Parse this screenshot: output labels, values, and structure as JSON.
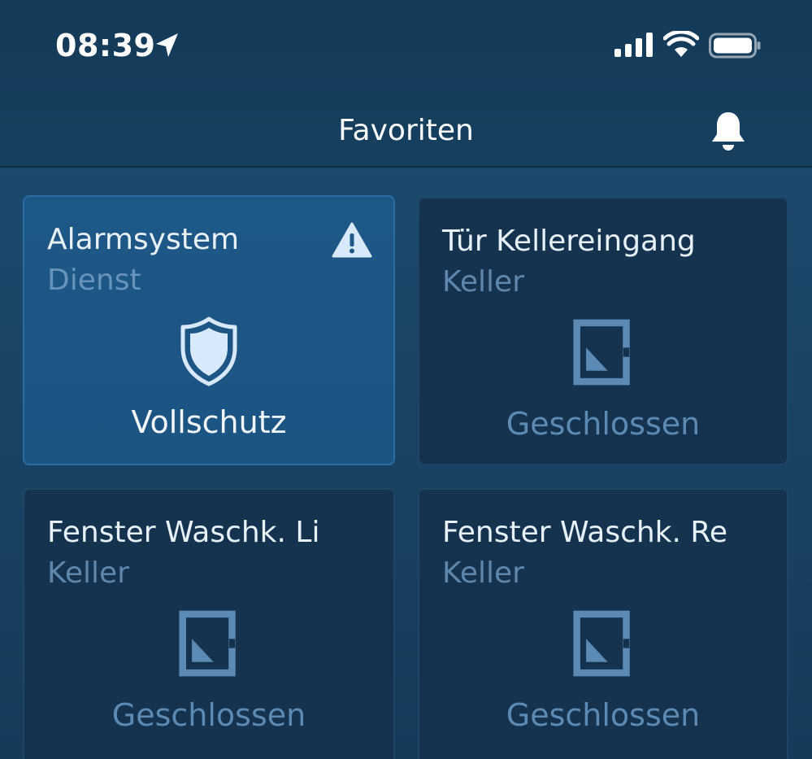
{
  "status_bar": {
    "time": "08:39",
    "location_icon": "location-arrow-icon",
    "signal_icon": "cellular-signal-icon",
    "wifi_icon": "wifi-icon",
    "battery_icon": "battery-icon"
  },
  "header": {
    "title": "Favoriten",
    "notification_icon": "bell-icon"
  },
  "colors": {
    "background": "#1a4668",
    "tile_background": "#15334f",
    "active_tile_background": "#1e5886",
    "muted_text": "#5e87ad",
    "icon_blue": "#5b8ab4",
    "icon_light": "#d8e9fb"
  },
  "tiles": [
    {
      "title": "Alarmsystem",
      "subtitle": "Dienst",
      "status": "Vollschutz",
      "icon": "shield-icon",
      "badge_icon": "warning-icon",
      "active": true
    },
    {
      "title": "Tür Kellereingang",
      "subtitle": "Keller",
      "status": "Geschlossen",
      "icon": "door-closed-icon",
      "active": false
    },
    {
      "title": "Fenster Waschk. Li",
      "subtitle": "Keller",
      "status": "Geschlossen",
      "icon": "window-closed-icon",
      "active": false
    },
    {
      "title": "Fenster Waschk. Re",
      "subtitle": "Keller",
      "status": "Geschlossen",
      "icon": "window-closed-icon",
      "active": false
    }
  ]
}
